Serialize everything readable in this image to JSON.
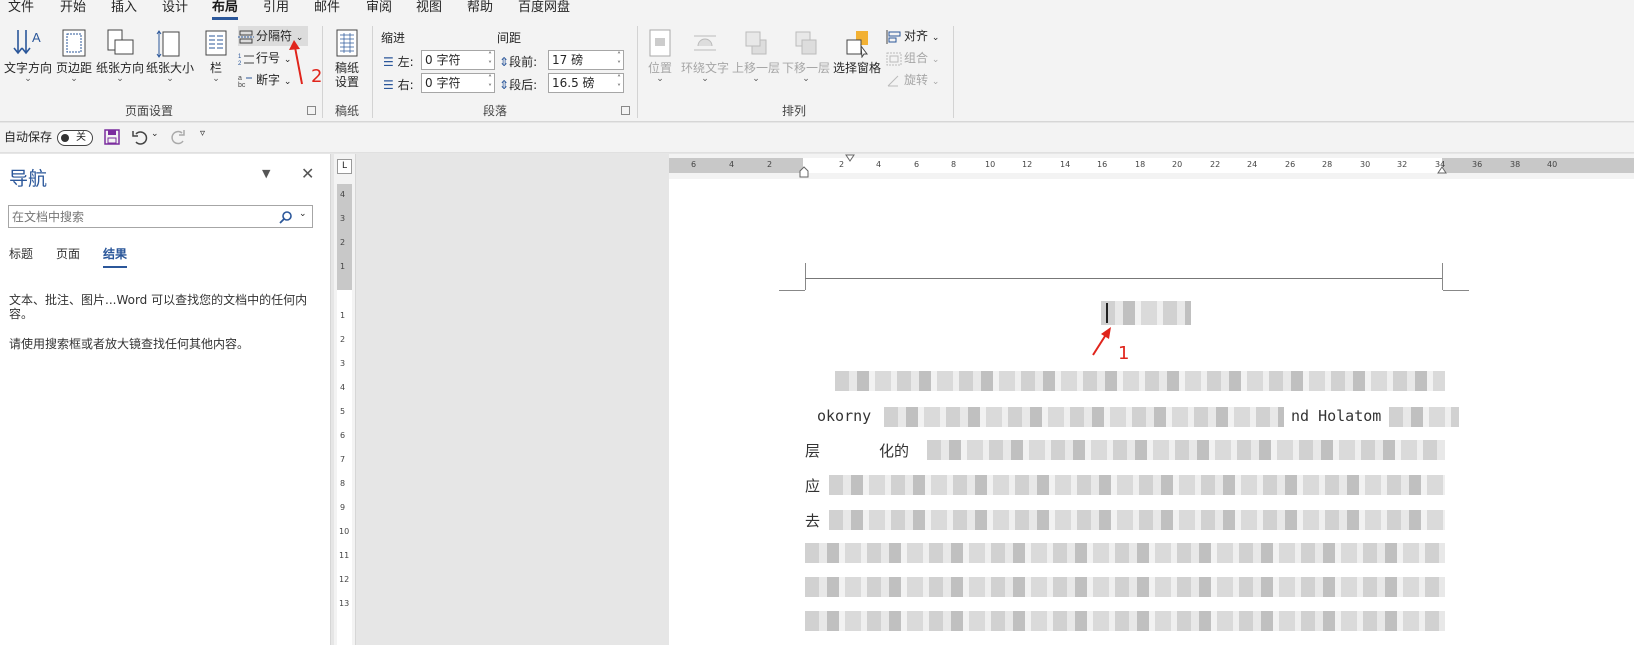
{
  "tabs": [
    "文件",
    "开始",
    "插入",
    "设计",
    "布局",
    "引用",
    "邮件",
    "审阅",
    "视图",
    "帮助",
    "百度网盘"
  ],
  "active_tab": "布局",
  "ribbon": {
    "page_setup": {
      "text_direction": "文字方向",
      "margins": "页边距",
      "orientation": "纸张方向",
      "size": "纸张大小",
      "columns": "栏",
      "breaks": "分隔符",
      "line_numbers": "行号",
      "hyphenation": "断字",
      "group_label": "页面设置"
    },
    "manuscript": {
      "settings": "稿纸\n设置",
      "group_label": "稿纸"
    },
    "paragraph": {
      "indent_label": "缩进",
      "spacing_label": "间距",
      "left_label": "左:",
      "right_label": "右:",
      "left_value": "0 字符",
      "right_value": "0 字符",
      "before_label": "段前:",
      "after_label": "段后:",
      "before_value": "17 磅",
      "after_value": "16.5 磅",
      "group_label": "段落"
    },
    "arrange": {
      "position": "位置",
      "wrap_text": "环绕文字",
      "bring_forward": "上移一层",
      "send_backward": "下移一层",
      "selection_pane": "选择窗格",
      "align": "对齐",
      "group": "组合",
      "rotate": "旋转",
      "group_label": "排列"
    }
  },
  "qat": {
    "autosave_label": "自动保存",
    "autosave_state": "关"
  },
  "navigation": {
    "title": "导航",
    "search_placeholder": "在文档中搜索",
    "tabs": [
      "标题",
      "页面",
      "结果"
    ],
    "active_tab": "结果",
    "info_1": "文本、批注、图片...Word 可以查找您的文档中的任何内容。",
    "info_2": "请使用搜索框或者放大镜查找任何其他内容。"
  },
  "rulers": {
    "horizontal": [
      "6",
      "4",
      "2",
      "2",
      "4",
      "6",
      "8",
      "10",
      "12",
      "14",
      "16",
      "18",
      "20",
      "22",
      "24",
      "26",
      "28",
      "30",
      "32",
      "34",
      "36",
      "38",
      "40"
    ],
    "vertical": [
      "4",
      "3",
      "2",
      "1",
      "1",
      "2",
      "3",
      "4",
      "5",
      "6",
      "7",
      "8",
      "9",
      "10",
      "11",
      "12",
      "13"
    ]
  },
  "document": {
    "visible_fragments": [
      "okorny",
      "nd Holatom",
      "层",
      "化的",
      "应",
      "去"
    ]
  },
  "annotations": {
    "marker_1": "1",
    "marker_2": "2"
  },
  "colors": {
    "accent": "#2b579a",
    "annotation": "#e0241b"
  }
}
